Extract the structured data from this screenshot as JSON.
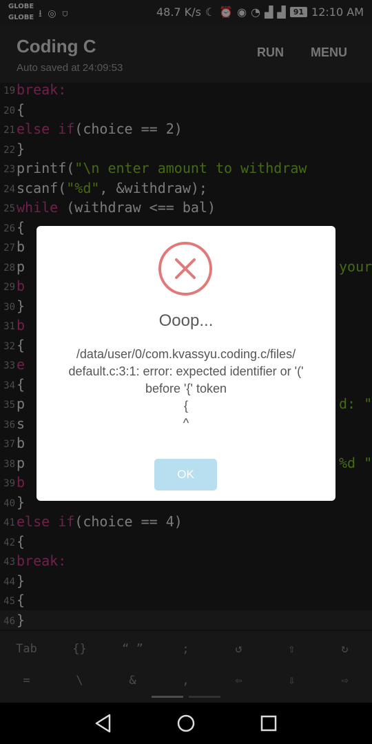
{
  "status": {
    "carrier1": "GLOBE",
    "carrier2": "GLOBE",
    "speed": "48.7 K/s",
    "battery": "91",
    "time": "12:10 AM"
  },
  "appbar": {
    "title": "Coding C",
    "subtitle": "Auto saved at 24:09:53",
    "run_label": "RUN",
    "menu_label": "MENU"
  },
  "editor": {
    "lines": [
      {
        "n": "19",
        "t": "break:",
        "kw": true
      },
      {
        "n": "20",
        "t": "{"
      },
      {
        "n": "21",
        "t": "else if(choice == 2)",
        "kwpre": "else if",
        "rest": "(choice == 2)"
      },
      {
        "n": "22",
        "t": "}"
      },
      {
        "n": "23",
        "t": "printf(\"\\n enter amount to withdraw",
        "pre": "printf(",
        "str": "\"\\n enter amount to withdraw"
      },
      {
        "n": "24",
        "t": "scanf(\"%d\", &withdraw);",
        "pre": "scanf(",
        "str": "\"%d\"",
        "post": ", &withdraw);"
      },
      {
        "n": "25",
        "t": "while (withdraw <== bal)",
        "kwpre": "while",
        "rest": " (withdraw <== bal)"
      },
      {
        "n": "26",
        "t": "{"
      },
      {
        "n": "27",
        "t": "b"
      },
      {
        "n": "28",
        "t": "p"
      },
      {
        "n": "29",
        "t": "b",
        "kw": true
      },
      {
        "n": "30",
        "t": "}"
      },
      {
        "n": "31",
        "t": "b",
        "kw": true
      },
      {
        "n": "32",
        "t": "{"
      },
      {
        "n": "33",
        "t": "e",
        "kw": true
      },
      {
        "n": "34",
        "t": "{"
      },
      {
        "n": "35",
        "t": "p"
      },
      {
        "n": "36",
        "t": "s"
      },
      {
        "n": "37",
        "t": "b"
      },
      {
        "n": "38",
        "t": "p"
      },
      {
        "n": "39",
        "t": "b",
        "kw": true
      },
      {
        "n": "40",
        "t": "}"
      },
      {
        "n": "41",
        "t": "else if(choice == 4)",
        "kwpre": "else if",
        "rest": "(choice == 4)"
      },
      {
        "n": "42",
        "t": "{"
      },
      {
        "n": "43",
        "t": "break:",
        "kw": true
      },
      {
        "n": "44",
        "t": "}"
      },
      {
        "n": "45",
        "t": "{"
      },
      {
        "n": "46",
        "t": "}"
      }
    ],
    "right_fragments": {
      "line28": "your",
      "line35": "d: \"",
      "line38": "%d \""
    }
  },
  "dialog": {
    "title": "Ooop...",
    "message": "/data/user/0/com.kvassyu.coding.c/files/\ndefault.c:3:1: error: expected identifier or '('\nbefore '{' token\n{\n^",
    "ok_label": "OK",
    "accent": "#b7dff0",
    "error_color": "#e07a7a"
  },
  "keyboard": {
    "row1": [
      "Tab",
      "{}",
      "“ ”",
      ";",
      "↺",
      "⇧",
      "↻"
    ],
    "row2": [
      "=",
      "\\",
      "&",
      ",",
      "⇦",
      "⇩",
      "⇨"
    ]
  }
}
